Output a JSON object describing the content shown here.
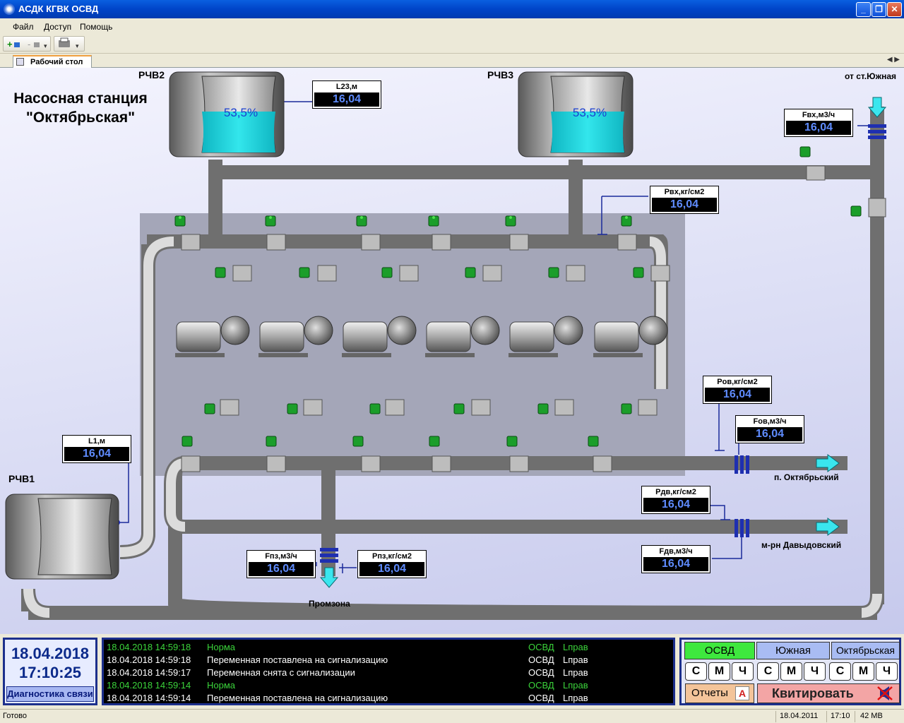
{
  "window": {
    "title": "АСДК КГВК ОСВД"
  },
  "menu": {
    "items": [
      "Файл",
      "Доступ",
      "Помощь"
    ]
  },
  "tabs": {
    "active": "Рабочий стол",
    "scroll": "◀ ▶"
  },
  "scheme": {
    "title_line1": "Насосная станция",
    "title_line2": "\"Октябрьская\"",
    "tanks": [
      {
        "label": "РЧВ2",
        "level_text": "53,5%",
        "level": 0.535
      },
      {
        "label": "РЧВ3",
        "level_text": "53,5%",
        "level": 0.535
      },
      {
        "label": "РЧВ1"
      }
    ],
    "labels": {
      "from": "от ст.Южная",
      "out1": "п. Октябрьский",
      "out2": "м-рн Давыдовский",
      "out3": "Промзона"
    },
    "measures": {
      "l23": {
        "title": "L23,м",
        "value": "16,04"
      },
      "fvh": {
        "title": "Fвх,м3/ч",
        "value": "16,04"
      },
      "pvh": {
        "title": "Pвх,кг/см2",
        "value": "16,04"
      },
      "pov": {
        "title": "Pов,кг/см2",
        "value": "16,04"
      },
      "fov": {
        "title": "Fов,м3/ч",
        "value": "16,04"
      },
      "l1": {
        "title": "L1,м",
        "value": "16,04"
      },
      "pdv": {
        "title": "Pдв,кг/см2",
        "value": "16,04"
      },
      "fdv": {
        "title": "Fдв,м3/ч",
        "value": "16,04"
      },
      "fpz": {
        "title": "Fпз,м3/ч",
        "value": "16,04"
      },
      "ppz": {
        "title": "Pпз,кг/см2",
        "value": "16,04"
      }
    }
  },
  "clock": {
    "date": "18.04.2018",
    "time": "17:10:25",
    "diag_label": "Диагностика связи"
  },
  "log": [
    {
      "ts": "18.04.2018 14:59:18",
      "msg": "Норма",
      "src": "ОСВД",
      "user": "Lправ",
      "color": "green"
    },
    {
      "ts": "18.04.2018 14:59:18",
      "msg": "Переменная поставлена на сигнализацию",
      "src": "ОСВД",
      "user": "Lправ",
      "color": "white"
    },
    {
      "ts": "18.04.2018 14:59:17",
      "msg": "Переменная снята с сигнализации",
      "src": "ОСВД",
      "user": "Lправ",
      "color": "white"
    },
    {
      "ts": "18.04.2018 14:59:14",
      "msg": "Норма",
      "src": "ОСВД",
      "user": "Lправ",
      "color": "green"
    },
    {
      "ts": "18.04.2018 14:59:14",
      "msg": "Переменная поставлена на сигнализацию",
      "src": "ОСВД",
      "user": "Lправ",
      "color": "white"
    }
  ],
  "control": {
    "stations": [
      "ОСВД",
      "Южная",
      "Октябрьская"
    ],
    "filters": [
      "С",
      "М",
      "Ч",
      "С",
      "М",
      "Ч",
      "С",
      "М",
      "Ч"
    ],
    "reports_label": "Отчеты",
    "report_icon": "A",
    "ack_label": "Квитировать"
  },
  "status": {
    "text": "Готово",
    "date": "18.04.2011",
    "time": "17:10",
    "mem": "42 MB"
  },
  "colors": {
    "titlebar": "#0a5fe0",
    "water": "#19d6dc",
    "osvd_active": "#3ee83e",
    "station_btn": "#a9bcf3",
    "ack": "#f3a5a5",
    "reports": "#f3c49a"
  }
}
